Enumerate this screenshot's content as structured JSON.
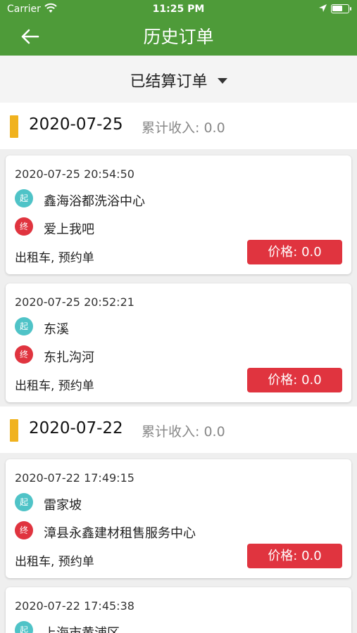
{
  "status": {
    "carrier": "Carrier",
    "time": "11:25 PM"
  },
  "nav": {
    "title": "历史订单"
  },
  "filter": {
    "label": "已结算订单"
  },
  "sections": [
    {
      "date": "2020-07-25",
      "income": "累计收入: 0.0",
      "orders": [
        {
          "time": "2020-07-25 20:54:50",
          "start_tag": "起",
          "start": "鑫海浴都洗浴中心",
          "end_tag": "终",
          "end": "爱上我吧",
          "type": "出租车, 预约单",
          "price": "价格: 0.0"
        },
        {
          "time": "2020-07-25 20:52:21",
          "start_tag": "起",
          "start": "东溪",
          "end_tag": "终",
          "end": "东扎沟河",
          "type": "出租车, 预约单",
          "price": "价格: 0.0"
        }
      ]
    },
    {
      "date": "2020-07-22",
      "income": "累计收入: 0.0",
      "orders": [
        {
          "time": "2020-07-22 17:49:15",
          "start_tag": "起",
          "start": "雷家坡",
          "end_tag": "终",
          "end": "漳县永鑫建材租售服务中心",
          "type": "出租车, 预约单",
          "price": "价格: 0.0"
        },
        {
          "time": "2020-07-22 17:45:38",
          "start_tag": "起",
          "start": "上海市黄浦区"
        }
      ]
    }
  ],
  "colors": {
    "nav_bg": "#4e9b39",
    "accent_bar": "#f0b21e",
    "start_dot": "#4fc3c7",
    "end_dot": "#e0343f",
    "price_bg": "#e0343f"
  }
}
